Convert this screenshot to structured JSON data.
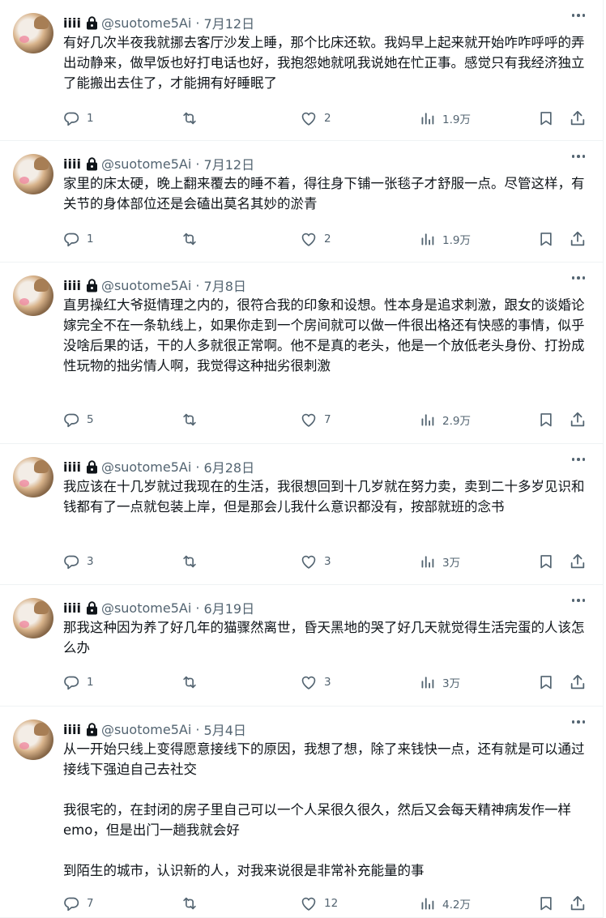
{
  "user": {
    "name": "iiii",
    "handle": "@suotome5Ai"
  },
  "tweets": [
    {
      "date": "7月12日",
      "paragraphs": [
        "有好几次半夜我就挪去客厅沙发上睡，那个比床还软。我妈早上起来就开始咋咋呼呼的弄出动静来，做早饭也好打电话也好，我抱怨她就吼我说她在忙正事。感觉只有我经济独立了能搬出去住了，才能拥有好睡眠了"
      ],
      "replies": "1",
      "retweets": "",
      "likes": "2",
      "views": "1.9万"
    },
    {
      "date": "7月12日",
      "paragraphs": [
        "家里的床太硬，晚上翻来覆去的睡不着，得往身下铺一张毯子才舒服一点。尽管这样，有关节的身体部位还是会磕出莫名其妙的淤青"
      ],
      "replies": "1",
      "retweets": "",
      "likes": "2",
      "views": "1.9万"
    },
    {
      "date": "7月8日",
      "paragraphs": [
        "直男操红大爷挺情理之内的，很符合我的印象和设想。性本身是追求刺激，跟女的谈婚论嫁完全不在一条轨线上，如果你走到一个房间就可以做一件很出格还有快感的事情，似乎没啥后果的话，干的人多就很正常啊。他不是真的老头，他是一个放低老头身份、打扮成性玩物的拙劣情人啊，我觉得这种拙劣很刺激"
      ],
      "replies": "5",
      "retweets": "",
      "likes": "7",
      "views": "2.9万"
    },
    {
      "date": "6月28日",
      "paragraphs": [
        "我应该在十几岁就过我现在的生活，我很想回到十几岁就在努力卖，卖到二十多岁见识和钱都有了一点就包装上岸，但是那会儿我什么意识都没有，按部就班的念书"
      ],
      "replies": "3",
      "retweets": "",
      "likes": "3",
      "views": "3万"
    },
    {
      "date": "6月19日",
      "paragraphs": [
        "那我这种因为养了好几年的猫骤然离世，昏天黑地的哭了好几天就觉得生活完蛋的人该怎么办"
      ],
      "replies": "1",
      "retweets": "",
      "likes": "3",
      "views": "3万"
    },
    {
      "date": "5月4日",
      "paragraphs": [
        "从一开始只线上变得愿意接线下的原因，我想了想，除了来钱快一点，还有就是可以通过接线下强迫自己去社交",
        "我很宅的，在封闭的房子里自己可以一个人呆很久很久，然后又会每天精神病发作一样emo，但是出门一趟我就会好",
        "到陌生的城市，认识新的人，对我来说很是非常补充能量的事"
      ],
      "replies": "7",
      "retweets": "",
      "likes": "12",
      "views": "4.2万"
    }
  ]
}
